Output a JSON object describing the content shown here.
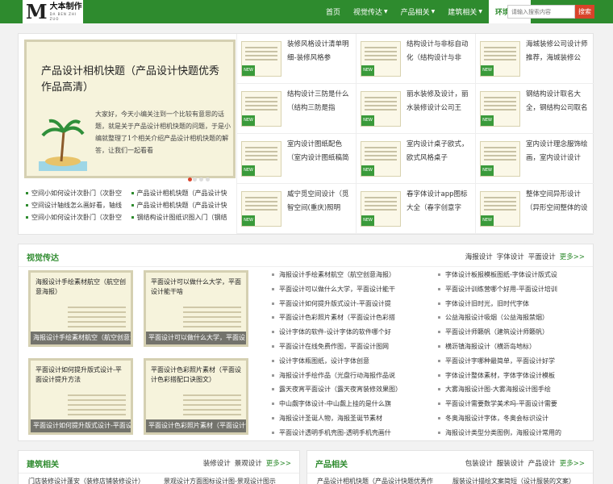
{
  "header": {
    "logo_mark": "M",
    "logo_cn": "大本制作",
    "logo_en": "DA BEN ZHI ZUO",
    "nav": [
      {
        "label": "首页"
      },
      {
        "label": "视觉传达"
      },
      {
        "label": "产品相关"
      },
      {
        "label": "建筑相关"
      },
      {
        "label": "环境艺术"
      }
    ],
    "search_placeholder": "请输入搜索内容",
    "search_button": "搜索"
  },
  "hero": {
    "title": "产品设计相机快题（产品设计快题优秀作品高清）",
    "body": "大家好，今天小编关注到一个比较有意思的话题，就是关于产品设计相机快题的问题，于是小编就整理了1个相关介绍产品设计相机快题的解答，让我们一起看看"
  },
  "hero_links": [
    "空间小如何设计次卧门（次卧空",
    "产品设计相机快题（产品设计快",
    "空间设计轴线怎么画好看，轴线",
    "产品设计相机快题（产品设计快",
    "空间小如何设计次卧门（次卧空",
    "钢结构设计图纸识图入门（钢结"
  ],
  "grid": [
    {
      "title": "装修风格设计清单明细-装修风格参"
    },
    {
      "title": "结构设计与非标自动化（结构设计与非"
    },
    {
      "title": "海城装修公司设计师推荐，海城装修公"
    },
    {
      "title": "结构设计三防是什么（结构三防是指"
    },
    {
      "title": "丽水装修及设计，丽水装修设计公司王"
    },
    {
      "title": "钢结构设计取名大全，钢结构公司取名"
    },
    {
      "title": "室内设计图纸配色（室内设计图纸稿简"
    },
    {
      "title": "室内设计桌子欧式，欧式风格桌子"
    },
    {
      "title": "室内设计理念服饰绘画，室内设计设计"
    },
    {
      "title": "威宁觅空间设计（觅智空间(重庆)照明"
    },
    {
      "title": "春字体设计app图标大全（春字创意字"
    },
    {
      "title": "整体空间异形设计（异形空间整体的设"
    }
  ],
  "new_badge": "NEW",
  "visual": {
    "title": "视觉传达",
    "links": [
      "海报设计",
      "字体设计",
      "平面设计"
    ],
    "more": "更多>>",
    "cards": [
      {
        "title": "海报设计手绘素材航空（航空创意海报）",
        "caption": "海报设计手绘素材航空（航空创意海"
      },
      {
        "title": "平面设计可以做什么大学，平面设计能干啥",
        "caption": "平面设计可以做什么大学，平面设"
      },
      {
        "title": "平面设计如何提升版式设计-平面设计提升方法",
        "caption": "平面设计如何提升版式设计-平面设"
      },
      {
        "title": "平面设计色彩照片素材（平面设计色彩搭配口诀图文）",
        "caption": "平面设计色彩照片素材（平面设计色"
      }
    ],
    "list_left": [
      "海报设计手绘素材航空（航空创意海报）",
      "平面设计可以做什么大学，平面设计能干",
      "平面设计如何提升版式设计-平面设计提",
      "平面设计色彩照片素材（平面设计色彩搭",
      "设计字体的软件-设计字体的软件哪个好",
      "平面设计在线免费作图，平面设计图网",
      "设计字体瓶图纸，设计字体创意",
      "海报设计手绘作品（光盘行动海报作品说",
      "露天夜宵平面设计（露天夜宵装修效果图）",
      "中山觑字体设计-中山觑上挂的是什么旗",
      "海报设计圣诞人物，海报圣诞节素材",
      "平面设计透明手机壳图-透明手机壳画什"
    ],
    "list_right": [
      "字体设计板报模板图纸-字体设计版式设",
      "平面设计训练营哪个好用-平面设计培训",
      "字体设计旧时光，旧时代字体",
      "公益海报设计吸烟（公益海报禁烟）",
      "平面设计师籁帆（建筑设计师籁帆）",
      "横沥镇海报设计（横沥岛地标）",
      "平面设计字哪种最简单，平面设计好学",
      "字体设计整体素材，字体字体设计模板",
      "大雾海报设计图-大雾海报设计图手绘",
      "平面设计需要数学美术吗-平面设计需要",
      "冬奥海报设计字体，冬奥会标识设计",
      "海报设计类型分类图例，海报设计常用的"
    ]
  },
  "architecture": {
    "title": "建筑相关",
    "links": [
      "装修设计",
      "景观设计"
    ],
    "more": "更多>>",
    "items": [
      "门店装修设计蓬安（装修店铺装修设计）",
      "景观设计方面图标设计图-景观设计图示"
    ]
  },
  "product": {
    "title": "产品相关",
    "links": [
      "包装设计",
      "服装设计",
      "产品设计"
    ],
    "more": "更多>>",
    "items": [
      "产品设计相机快题（产品设计快题优秀作",
      "服装设计描绘文案简短（设计服装的文案）"
    ]
  }
}
